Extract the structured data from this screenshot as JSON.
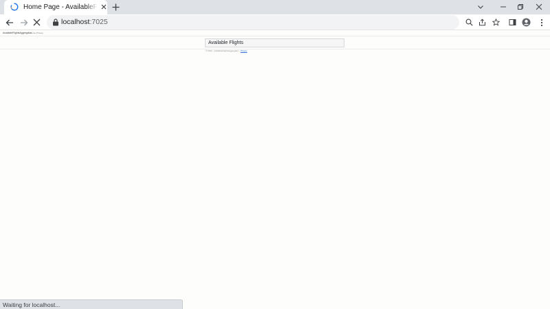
{
  "browser": {
    "tab": {
      "title": "Home Page - AvailableFlightsAggregator",
      "favicon_icon": "loading-spinner-icon",
      "close_icon": "close-icon"
    },
    "new_tab_icon": "plus-icon",
    "window_controls": [
      "chevron-down-icon",
      "minimize-icon",
      "restore-icon",
      "close-icon"
    ],
    "toolbar": {
      "back_icon": "arrow-left-icon",
      "forward_icon": "arrow-right-icon",
      "stop_icon": "stop-icon",
      "url_host": "localhost",
      "url_port": ":7025",
      "right_icons": [
        "zoom-icon",
        "share-icon",
        "star-icon",
        "side-panel-icon",
        "profile-icon",
        "more-menu-icon"
      ]
    },
    "status": "Waiting for localhost..."
  },
  "page": {
    "brand": "AvailableFlightsAggregator",
    "nav": [
      "Home",
      "Privacy"
    ],
    "panel_title": "Available Flights",
    "footer": {
      "copyright": "© 2023 - AvailableFlightsAggregator -",
      "link": "Privacy"
    }
  },
  "colors": {
    "tabstrip": "#dee1e6",
    "page_bg": "#fdfdfb",
    "link": "#2f6fd6"
  }
}
